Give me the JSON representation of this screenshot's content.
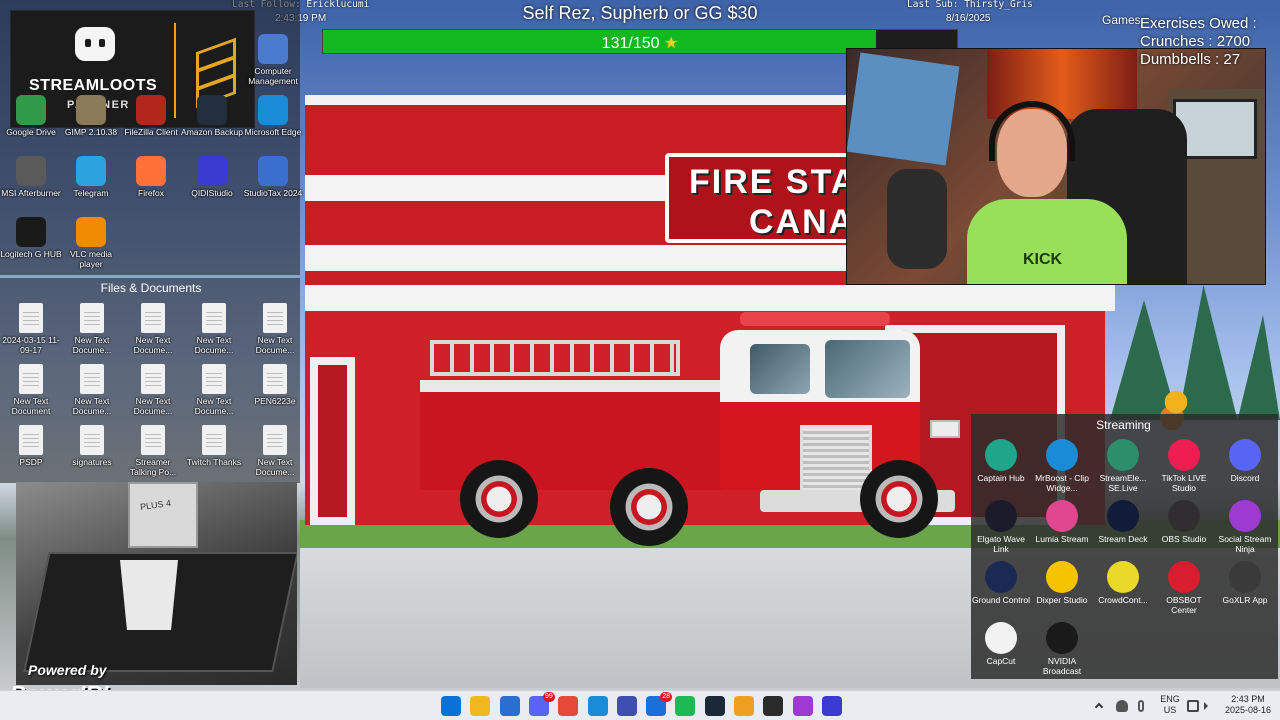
{
  "top_bar": {
    "last_follow": "Last Follow: Ericklucumi",
    "stream_time": "2:43:19 PM",
    "last_sub": "Last Sub: Thirsty_Gris",
    "date": "8/16/2025"
  },
  "goal": {
    "title": "Self Rez, Supherb or GG $30",
    "label": "131/150",
    "progress_fraction": 0.873,
    "star_icon": "star-icon",
    "fill_color": "#12b81f"
  },
  "branding": {
    "name": "STREAMLOOTS",
    "sub": "PARTNER",
    "accent_color": "#e5a623"
  },
  "desktop_icons": [
    {
      "label": "Computer Management",
      "icon": "computer-management-icon",
      "color": "#4a7bd1"
    },
    {
      "label": "Google Drive",
      "icon": "google-drive-icon",
      "color": "#2f9b4a"
    },
    {
      "label": "GIMP 2.10.38",
      "icon": "gimp-icon",
      "color": "#8a7a5a"
    },
    {
      "label": "FileZilla Client",
      "icon": "filezilla-icon",
      "color": "#b3261e"
    },
    {
      "label": "Amazon Backup",
      "icon": "amazon-backup-icon",
      "color": "#232f3e"
    },
    {
      "label": "Microsoft Edge",
      "icon": "edge-icon",
      "color": "#1a8bd6"
    },
    {
      "label": "MSI Afterburner",
      "icon": "msi-afterburner-icon",
      "color": "#5a5a5a"
    },
    {
      "label": "Telegram",
      "icon": "telegram-icon",
      "color": "#2aa3df"
    },
    {
      "label": "Firefox",
      "icon": "firefox-icon",
      "color": "#ff7139"
    },
    {
      "label": "QIDIStudio",
      "icon": "qidistudio-icon",
      "color": "#3a3ad0"
    },
    {
      "label": "StudioTax 2024",
      "icon": "studiotax-icon",
      "color": "#3a6fd0"
    },
    {
      "label": "Logitech G HUB",
      "icon": "logitech-ghub-icon",
      "color": "#1a1a1a"
    },
    {
      "label": "VLC media player",
      "icon": "vlc-icon",
      "color": "#f08a00"
    }
  ],
  "files_section": {
    "title": "Files & Documents",
    "items": [
      "2024-03-15 11-09-17",
      "New Text Docume...",
      "New Text Docume...",
      "New Text Docume...",
      "New Text Docume...",
      "New Text Document",
      "New Text Docume...",
      "New Text Docume...",
      "New Text Docume...",
      "PEN6223e",
      "PSDP",
      "signatures",
      "Streamer Talking Po...",
      "Twitch Thanks",
      "New Text Docume..."
    ]
  },
  "printer_cam": {
    "head_label": "PLUS 4"
  },
  "powered": {
    "line1": "Powered by",
    "line2": "PowerIRL"
  },
  "webcam": {
    "shirt_text": "KICK"
  },
  "games": {
    "label": "Games"
  },
  "exercises": {
    "title": "Exercises Owed :",
    "crunches": "Crunches : 2700",
    "dumbbells": "Dumbbells : 27"
  },
  "fire_station": {
    "sign_line1": "FIRE STA",
    "sign_line2": "CANA"
  },
  "streaming_panel": {
    "title": "Streaming",
    "apps": [
      {
        "label": "Captain Hub",
        "icon": "captain-hub-icon",
        "color": "#1fa58a"
      },
      {
        "label": "MrBoost - Clip Widge...",
        "icon": "edge-icon",
        "color": "#1a8bd6"
      },
      {
        "label": "StreamEle... SE.Live",
        "icon": "streamelements-icon",
        "color": "#2a8f6a"
      },
      {
        "label": "TikTok LIVE Studio",
        "icon": "tiktok-icon",
        "color": "#ee1d52"
      },
      {
        "label": "Discord",
        "icon": "discord-icon",
        "color": "#5865f2"
      },
      {
        "label": "Elgato Wave Link",
        "icon": "elgato-wave-icon",
        "color": "#1b1b2b"
      },
      {
        "label": "Lumia Stream",
        "icon": "lumia-stream-icon",
        "color": "#e0478f"
      },
      {
        "label": "Stream Deck",
        "icon": "stream-deck-icon",
        "color": "#111c3a"
      },
      {
        "label": "OBS Studio",
        "icon": "obs-icon",
        "color": "#302e31"
      },
      {
        "label": "Social Stream Ninja",
        "icon": "social-stream-ninja-icon",
        "color": "#9d3ad0"
      },
      {
        "label": "Ground Control",
        "icon": "ground-control-icon",
        "color": "#1b2a55"
      },
      {
        "label": "Dixper Studio",
        "icon": "dixper-icon",
        "color": "#f5c400"
      },
      {
        "label": "CrowdCont...",
        "icon": "crowdcontrol-icon",
        "color": "#e9d92a"
      },
      {
        "label": "OBSBOT Center",
        "icon": "obsbot-icon",
        "color": "#d81e2e"
      },
      {
        "label": "GoXLR App",
        "icon": "goxlr-icon",
        "color": "#3a3a3a"
      },
      {
        "label": "CapCut",
        "icon": "capcut-icon",
        "color": "#f2f2f2"
      },
      {
        "label": "NVIDIA Broadcast",
        "icon": "nvidia-broadcast-icon",
        "color": "#1a1a1a"
      }
    ]
  },
  "taskbar": {
    "apps": [
      {
        "icon": "windows-start-icon",
        "color": "#0a72d4",
        "badge": ""
      },
      {
        "icon": "file-explorer-icon",
        "color": "#f2b821",
        "badge": ""
      },
      {
        "icon": "microsoft-store-icon",
        "color": "#2a6fd0",
        "badge": ""
      },
      {
        "icon": "discord-icon",
        "color": "#5865f2",
        "badge": "99"
      },
      {
        "icon": "chrome-icon",
        "color": "#e64a3a",
        "badge": ""
      },
      {
        "icon": "edge-icon",
        "color": "#1a8bd6",
        "badge": ""
      },
      {
        "icon": "msi-center-icon",
        "color": "#3f4fb0",
        "badge": ""
      },
      {
        "icon": "mail-icon",
        "color": "#1b6fd8",
        "badge": "28"
      },
      {
        "icon": "spotify-icon",
        "color": "#1db954",
        "badge": ""
      },
      {
        "icon": "steam-icon",
        "color": "#1b2838",
        "badge": ""
      },
      {
        "icon": "qidistudio-icon",
        "color": "#f0a020",
        "badge": ""
      },
      {
        "icon": "terminal-icon",
        "color": "#2b2b2b",
        "badge": ""
      },
      {
        "icon": "social-stream-ninja-icon",
        "color": "#9d3ad0",
        "badge": ""
      },
      {
        "icon": "qidi-app-icon",
        "color": "#3a3ad0",
        "badge": ""
      }
    ],
    "language_line1": "ENG",
    "language_line2": "US",
    "time": "2:43 PM",
    "date": "2025-08-16"
  }
}
